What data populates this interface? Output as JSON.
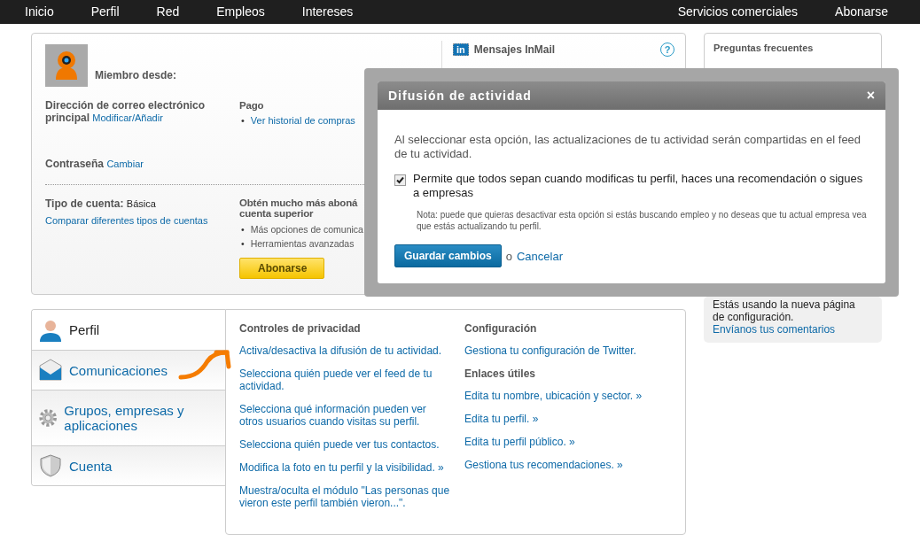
{
  "top_nav": {
    "left": [
      "Inicio",
      "Perfil",
      "Red",
      "Empleos",
      "Intereses"
    ],
    "right": [
      "Servicios comerciales",
      "Abonarse"
    ]
  },
  "account": {
    "member_since_label": "Miembro desde:",
    "email_label": "Dirección de correo electrónico principal",
    "email_link": "Modificar/Añadir",
    "payment_title": "Pago",
    "payment_links": [
      "Ver historial de compras"
    ],
    "password_label": "Contraseña",
    "password_link": "Cambiar",
    "account_type_label": "Tipo de cuenta:",
    "account_type": "Básica",
    "compare_link": "Comparar diferentes tipos de cuentas",
    "upgrade_title": [
      "Obtén mucho más aboná",
      "cuenta superior"
    ],
    "bullet": "•",
    "upgrade_items": [
      "Más opciones de comunica",
      "Herramientas avanzadas"
    ],
    "upgrade_button": "Abonarse"
  },
  "inmail": {
    "logo": "in",
    "title": "Mensajes InMail",
    "help": "?"
  },
  "faq": {
    "title": "Preguntas frecuentes"
  },
  "feedback": {
    "text": "Estás usando la nueva página de configuración.",
    "link": "Envíanos tus comentarios"
  },
  "sections": [
    {
      "label": "Perfil",
      "selected": true
    },
    {
      "label": "Comunicaciones",
      "selected": false
    },
    {
      "label": "Grupos, empresas y aplicaciones",
      "selected": false
    },
    {
      "label": "Cuenta",
      "selected": false
    }
  ],
  "columns": [
    {
      "groups": [
        {
          "title": "Controles de privacidad",
          "links": [
            "Activa/desactiva la difusión de tu actividad.",
            "Selecciona quién puede ver el feed de tu actividad.",
            "Selecciona qué información pueden ver otros usuarios cuando visitas su perfil.",
            "Selecciona quién puede ver tus contactos.",
            "Modifica la foto en tu perfil y la visibilidad. »",
            "Muestra/oculta el módulo \"Las personas que vieron este perfil también vieron...\"."
          ]
        }
      ]
    },
    {
      "groups": [
        {
          "title": "Configuración",
          "links": [
            "Gestiona tu configuración de Twitter."
          ]
        },
        {
          "title": "Enlaces útiles",
          "links": [
            "Edita tu nombre, ubicación y sector. »",
            "Edita tu perfil. »",
            "Edita tu perfil público. »",
            "Gestiona tus recomendaciones. »"
          ]
        }
      ]
    }
  ],
  "dialog": {
    "title": "Difusión de actividad",
    "close": "×",
    "description": "Al seleccionar esta opción, las actualizaciones de tu actividad serán compartidas en el feed de tu actividad.",
    "option": {
      "label": "Permite que todos sepan cuando modificas tu perfil, haces una recomendación o sigues a empresas",
      "checked": true
    },
    "note": "Nota: puede que quieras desactivar esta opción si estás buscando empleo y no deseas que tu actual empresa vea que estás actualizando tu perfil.",
    "save": "Guardar cambios",
    "or": "o",
    "cancel": "Cancelar"
  }
}
